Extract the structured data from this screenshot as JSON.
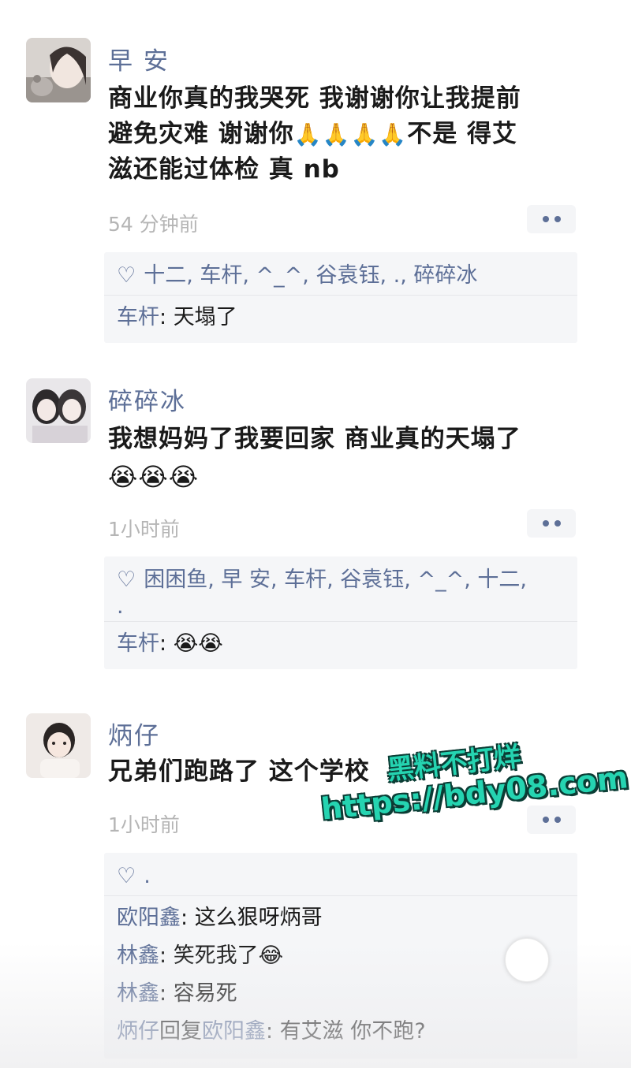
{
  "posts": [
    {
      "name": "早 安",
      "content_lines": [
        "商业你真的我哭死  我谢谢你让我提前",
        "避免灾难 谢谢你",
        "滋还能过体检 真 nb"
      ],
      "content_line2_tail": "不是 得艾",
      "emoji_inline": "🙏🙏🙏🙏",
      "time": "54 分钟前",
      "likes": "十二, 车杆, ^_^, 谷袁钰, ., 碎碎冰",
      "replies": [
        {
          "who": "车杆",
          "sep": ": ",
          "text": "天塌了"
        }
      ]
    },
    {
      "name": "碎碎冰",
      "content_lines": [
        "我想妈妈了我要回家 商业真的天塌了"
      ],
      "emoji_line": "😭😭😭",
      "time": "1小时前",
      "likes": "困困鱼, 早 安, 车杆, 谷袁钰, ^_^, 十二,",
      "likes_line2": ".",
      "replies": [
        {
          "who": "车杆",
          "sep": ": ",
          "text": "😭😭"
        }
      ]
    },
    {
      "name": "炳仔",
      "content_lines": [
        "兄弟们跑路了 这个学校"
      ],
      "time": "1小时前",
      "likes": ".",
      "replies": [
        {
          "who": "欧阳鑫",
          "sep": ": ",
          "text": "这么狠呀炳哥"
        },
        {
          "who": "林鑫",
          "sep": ": ",
          "text": "笑死我了😂"
        },
        {
          "who": "林鑫",
          "sep": ": ",
          "text": "容易死"
        },
        {
          "who": "炳仔",
          "mid": "回复",
          "who2": "欧阳鑫",
          "sep": ": ",
          "text": "有艾滋 你不跑?"
        }
      ]
    }
  ],
  "watermark": {
    "line1": "黑料不打烊",
    "line2": "https://bdy08.com"
  },
  "colors": {
    "name": "#5d6f97",
    "time": "#b5b5b5",
    "box_bg": "#f5f6f8",
    "watermark": "#25d4b1"
  },
  "icons": [
    "heart-icon",
    "more-icon",
    "avatar"
  ]
}
